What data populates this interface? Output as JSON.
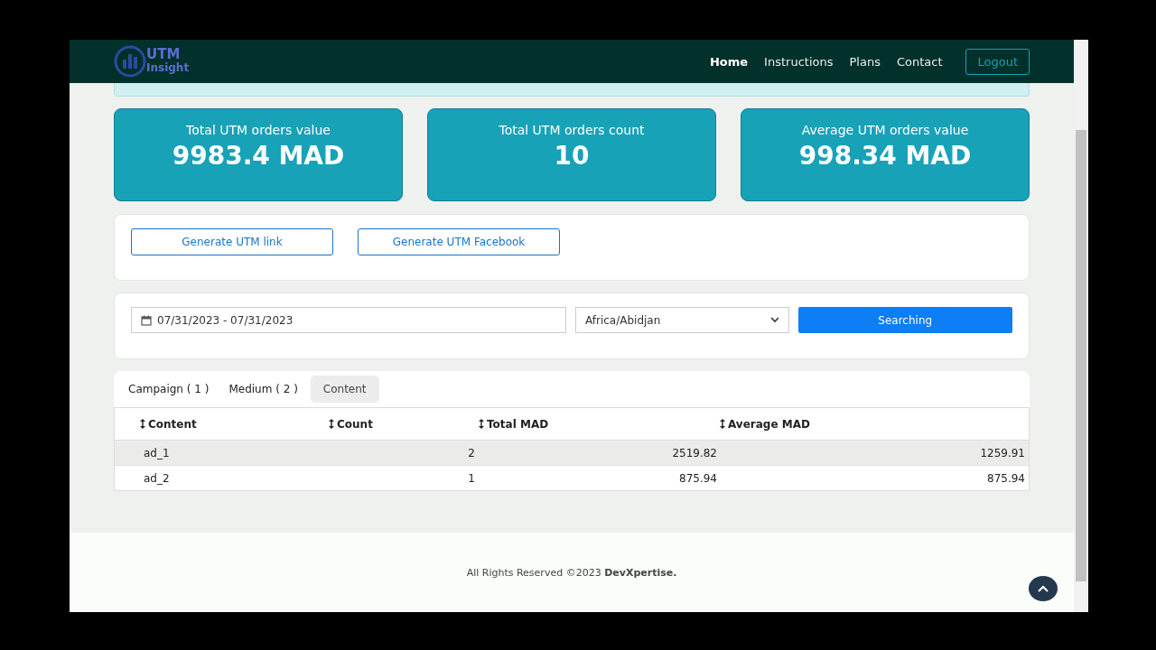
{
  "navbar": {
    "logo_text": [
      "UTM",
      "Insight"
    ],
    "links": [
      {
        "label": "Home",
        "selected": true
      },
      {
        "label": "Instructions",
        "selected": false
      },
      {
        "label": "Plans",
        "selected": false
      },
      {
        "label": "Contact",
        "selected": false
      }
    ],
    "logout": "Logout"
  },
  "stats": [
    {
      "label": "Total UTM orders value",
      "value": "9983.4 MAD"
    },
    {
      "label": "Total UTM orders count",
      "value": "10"
    },
    {
      "label": "Average UTM orders value",
      "value": "998.34 MAD"
    }
  ],
  "generate_buttons": [
    "Generate UTM link",
    "Generate UTM Facebook"
  ],
  "filter": {
    "date_range": "07/31/2023 - 07/31/2023",
    "timezone": "Africa/Abidjan",
    "search_button": "Searching"
  },
  "tabs": [
    {
      "label": "Campaign ( 1 )",
      "selected": false
    },
    {
      "label": "Medium ( 2 )",
      "selected": false
    },
    {
      "label": "Content",
      "selected": true
    }
  ],
  "table": {
    "columns": [
      "Content",
      "Count",
      "Total MAD",
      "Average MAD"
    ],
    "rows": [
      {
        "cells": [
          "ad_1",
          "2",
          "2519.82",
          "1259.91"
        ],
        "selected": true
      },
      {
        "cells": [
          "ad_2",
          "1",
          "875.94",
          "875.94"
        ],
        "selected": false
      }
    ]
  },
  "footer": "All Rights Reserved ©2023 **DevXpertise.**"
}
